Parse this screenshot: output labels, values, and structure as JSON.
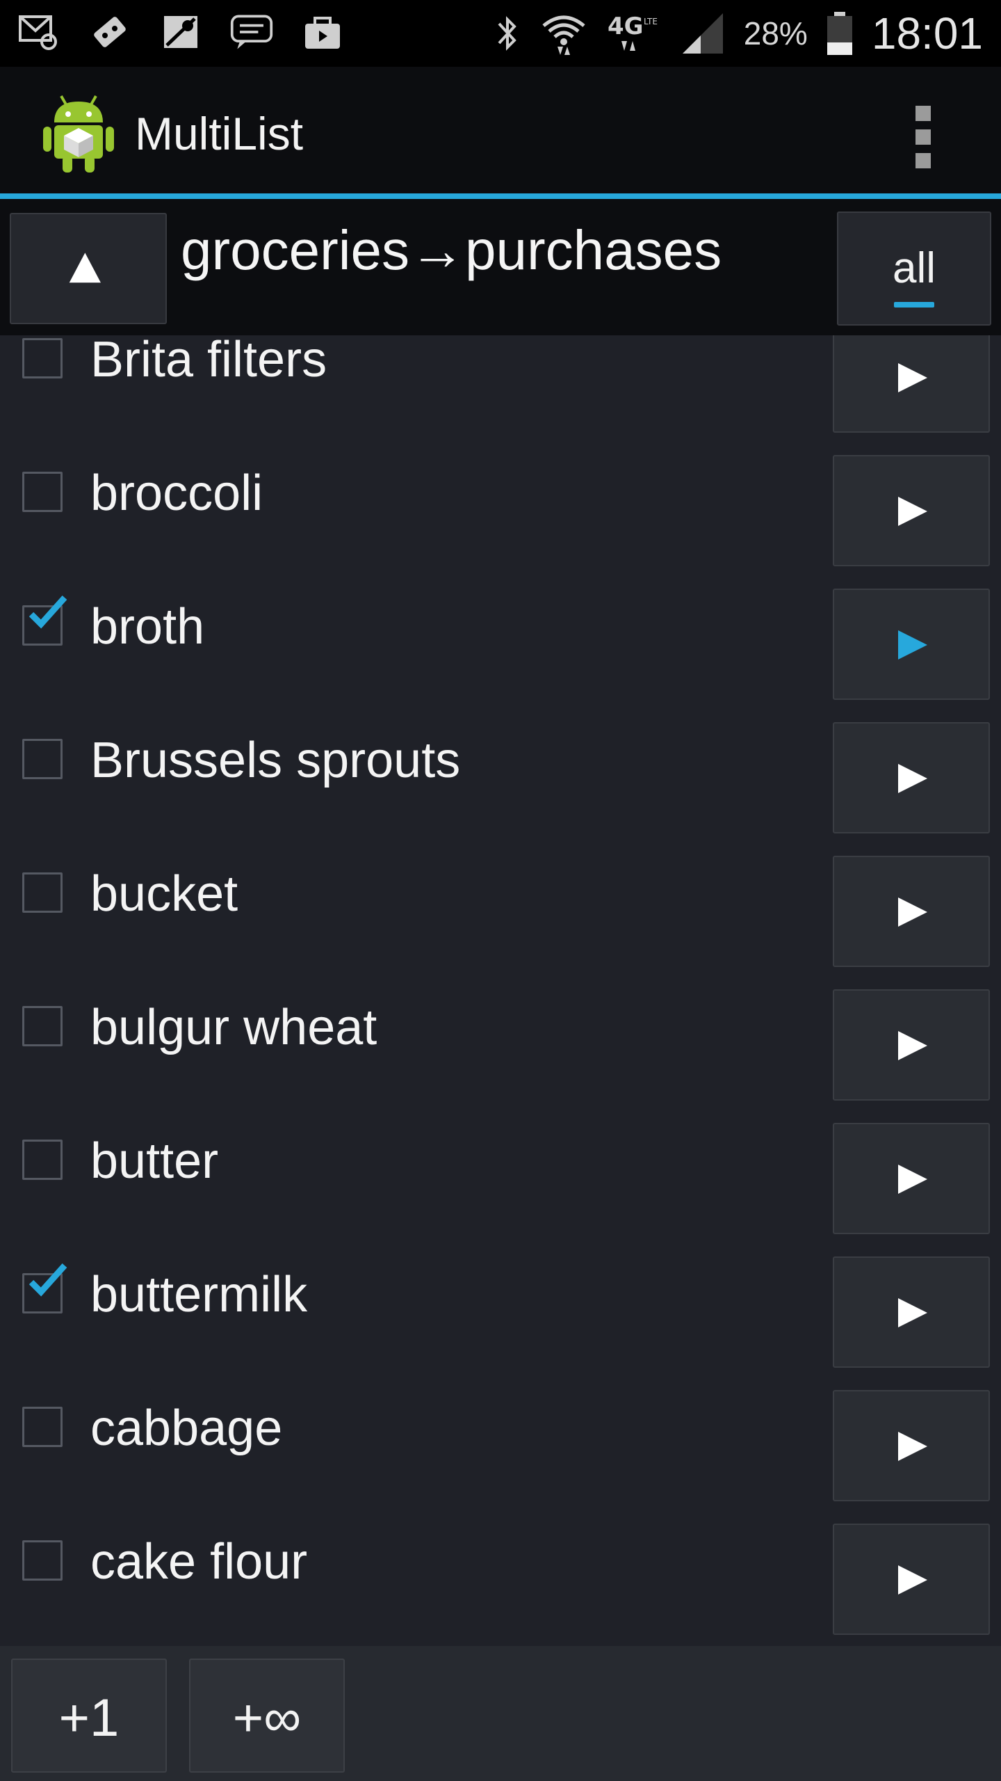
{
  "status_bar": {
    "battery_percent": "28%",
    "time": "18:01",
    "network_type": "4G LTE",
    "icons": [
      "email-icon",
      "game-icon",
      "maps-icon",
      "messaging-icon",
      "shopping-bag-icon",
      "bluetooth-icon",
      "wifi-icon",
      "signal-icon",
      "battery-icon"
    ]
  },
  "action_bar": {
    "title": "MultiList",
    "icons": [
      "app-icon",
      "overflow-menu-icon"
    ]
  },
  "path_bar": {
    "path": "groceries→purchases",
    "filter_label": "all",
    "icons": [
      "up-arrow-icon"
    ]
  },
  "items": [
    {
      "label": "Brita filters",
      "checked": false,
      "active": false
    },
    {
      "label": "broccoli",
      "checked": false,
      "active": false
    },
    {
      "label": "broth",
      "checked": true,
      "active": true
    },
    {
      "label": "Brussels sprouts",
      "checked": false,
      "active": false
    },
    {
      "label": "bucket",
      "checked": false,
      "active": false
    },
    {
      "label": "bulgur wheat",
      "checked": false,
      "active": false
    },
    {
      "label": "butter",
      "checked": false,
      "active": false
    },
    {
      "label": "buttermilk",
      "checked": true,
      "active": false
    },
    {
      "label": "cabbage",
      "checked": false,
      "active": false
    },
    {
      "label": "cake flour",
      "checked": false,
      "active": false
    }
  ],
  "bottom_bar": {
    "add_one_label": "+1",
    "add_infinite_label": "+∞"
  },
  "colors": {
    "accent": "#27a8dc",
    "background": "#1f2128",
    "bar": "#0c0d10"
  }
}
